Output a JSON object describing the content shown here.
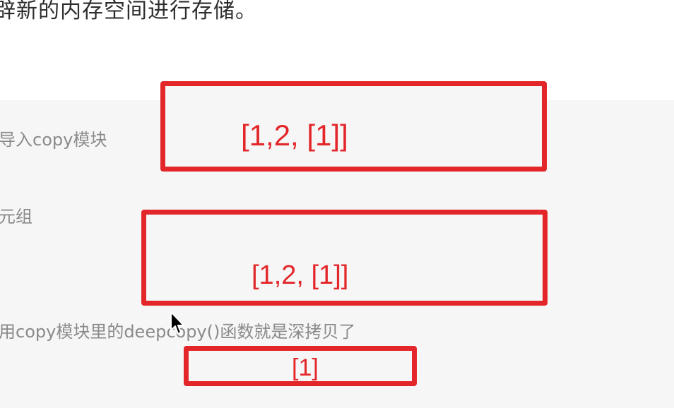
{
  "article": {
    "intro_line": "辟新的内存空间进行存储。"
  },
  "code_block": {
    "comments": [
      "导入copy模块",
      "元组",
      "用copy模块里的deepcopy()函数就是深拷贝了"
    ]
  },
  "annotations": {
    "boxes": [
      {
        "value": "[1,2, [1]]"
      },
      {
        "value": "[1,2, [1]]"
      },
      {
        "value": "[1]"
      }
    ],
    "color": "#e3262a"
  },
  "cursor": {
    "icon": "arrow-cursor-icon"
  }
}
